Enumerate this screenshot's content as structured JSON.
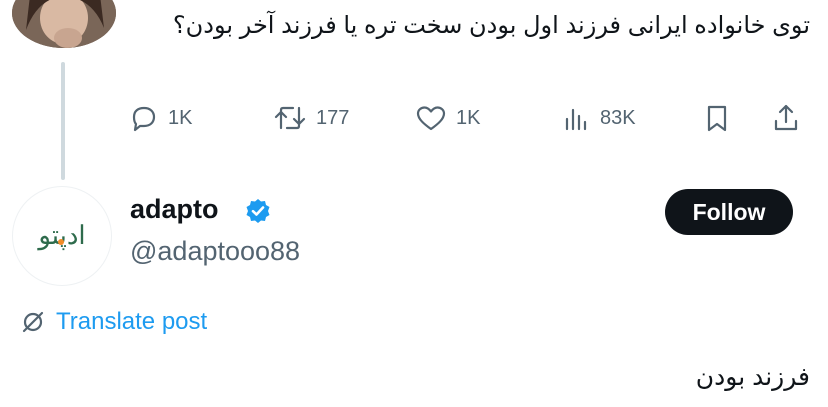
{
  "original_post": {
    "text": "توی خانواده ایرانی فرزند اول بودن سخت تره یا فرزند آخر بودن؟",
    "actions": {
      "replies": "1K",
      "reposts": "177",
      "likes": "1K",
      "views": "83K"
    }
  },
  "reply_account": {
    "avatar_logo_text": "ادپتو",
    "display_name": "adapto",
    "handle": "@adaptooo88",
    "verified": true,
    "follow_label": "Follow"
  },
  "translate_label": "Translate post",
  "reply_post": {
    "text": "فرزند بودن"
  },
  "colors": {
    "accent": "#1d9bf0",
    "text": "#0f1419",
    "muted": "#536471",
    "thread_line": "#cfd9de",
    "logo_green": "#2e6b4c",
    "logo_orange": "#f28c28"
  },
  "icons": [
    "reply-icon",
    "repost-icon",
    "like-icon",
    "views-icon",
    "bookmark-icon",
    "share-icon",
    "verified-badge-icon",
    "translate-icon"
  ]
}
